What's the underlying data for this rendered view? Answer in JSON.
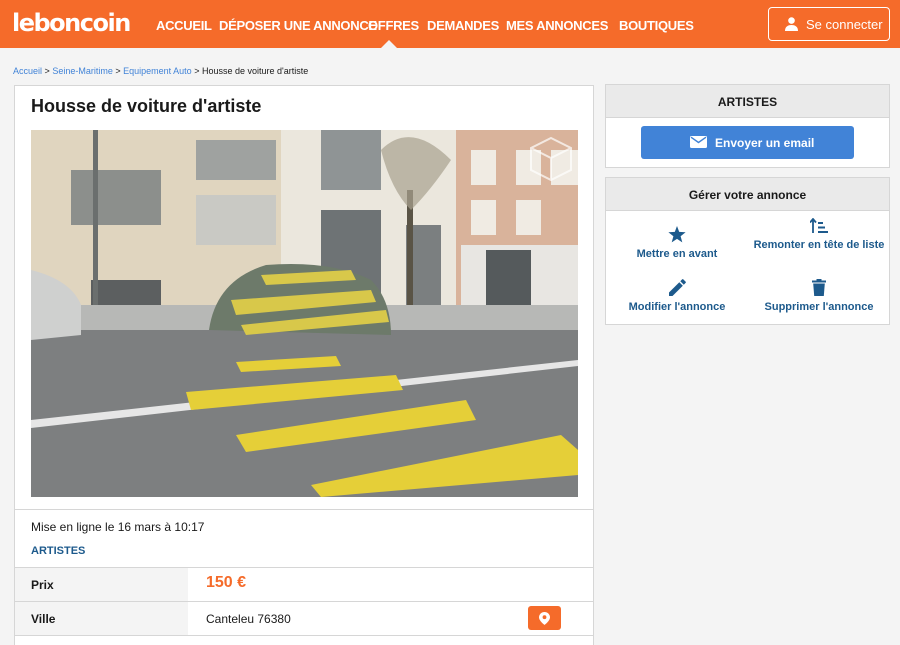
{
  "header": {
    "logo": "leboncoin",
    "nav": [
      {
        "label": "ACCUEIL"
      },
      {
        "label": "DÉPOSER UNE ANNONCE"
      },
      {
        "label": "OFFRES"
      },
      {
        "label": "DEMANDES"
      },
      {
        "label": "MES ANNONCES"
      },
      {
        "label": "BOUTIQUES"
      }
    ],
    "active_nav": "OFFRES",
    "login_label": "Se connecter",
    "login_icon": "person-icon"
  },
  "breadcrumb": {
    "items": [
      "Accueil",
      "Seine-Maritime",
      "Equipement Auto"
    ],
    "separator": ">",
    "current": "Housse de voiture d'artiste"
  },
  "ad": {
    "title": "Housse de voiture d'artiste",
    "photo_watermark_icon": "3d-cube-icon",
    "posted": "Mise en ligne le 16 mars à 10:17",
    "seller": "ARTISTES",
    "price_label": "Prix",
    "price": "150 €",
    "city_label": "Ville",
    "city": "Canteleu 76380",
    "map_icon": "location-pin-icon"
  },
  "contact": {
    "title": "ARTISTES",
    "email_label": "Envoyer un email",
    "email_icon": "envelope-icon"
  },
  "manage": {
    "title": "Gérer votre annonce",
    "actions": [
      {
        "label": "Mettre en avant",
        "icon": "star-icon"
      },
      {
        "label": "Remonter en tête de liste",
        "icon": "sort-up-icon"
      },
      {
        "label": "Modifier l'annonce",
        "icon": "pencil-icon"
      },
      {
        "label": "Supprimer l'annonce",
        "icon": "trash-icon"
      }
    ]
  },
  "colors": {
    "brand_orange": "#f56b2a",
    "link_blue": "#4183d7",
    "dark_blue": "#1d5a8c",
    "background": "#f4f4f4"
  }
}
